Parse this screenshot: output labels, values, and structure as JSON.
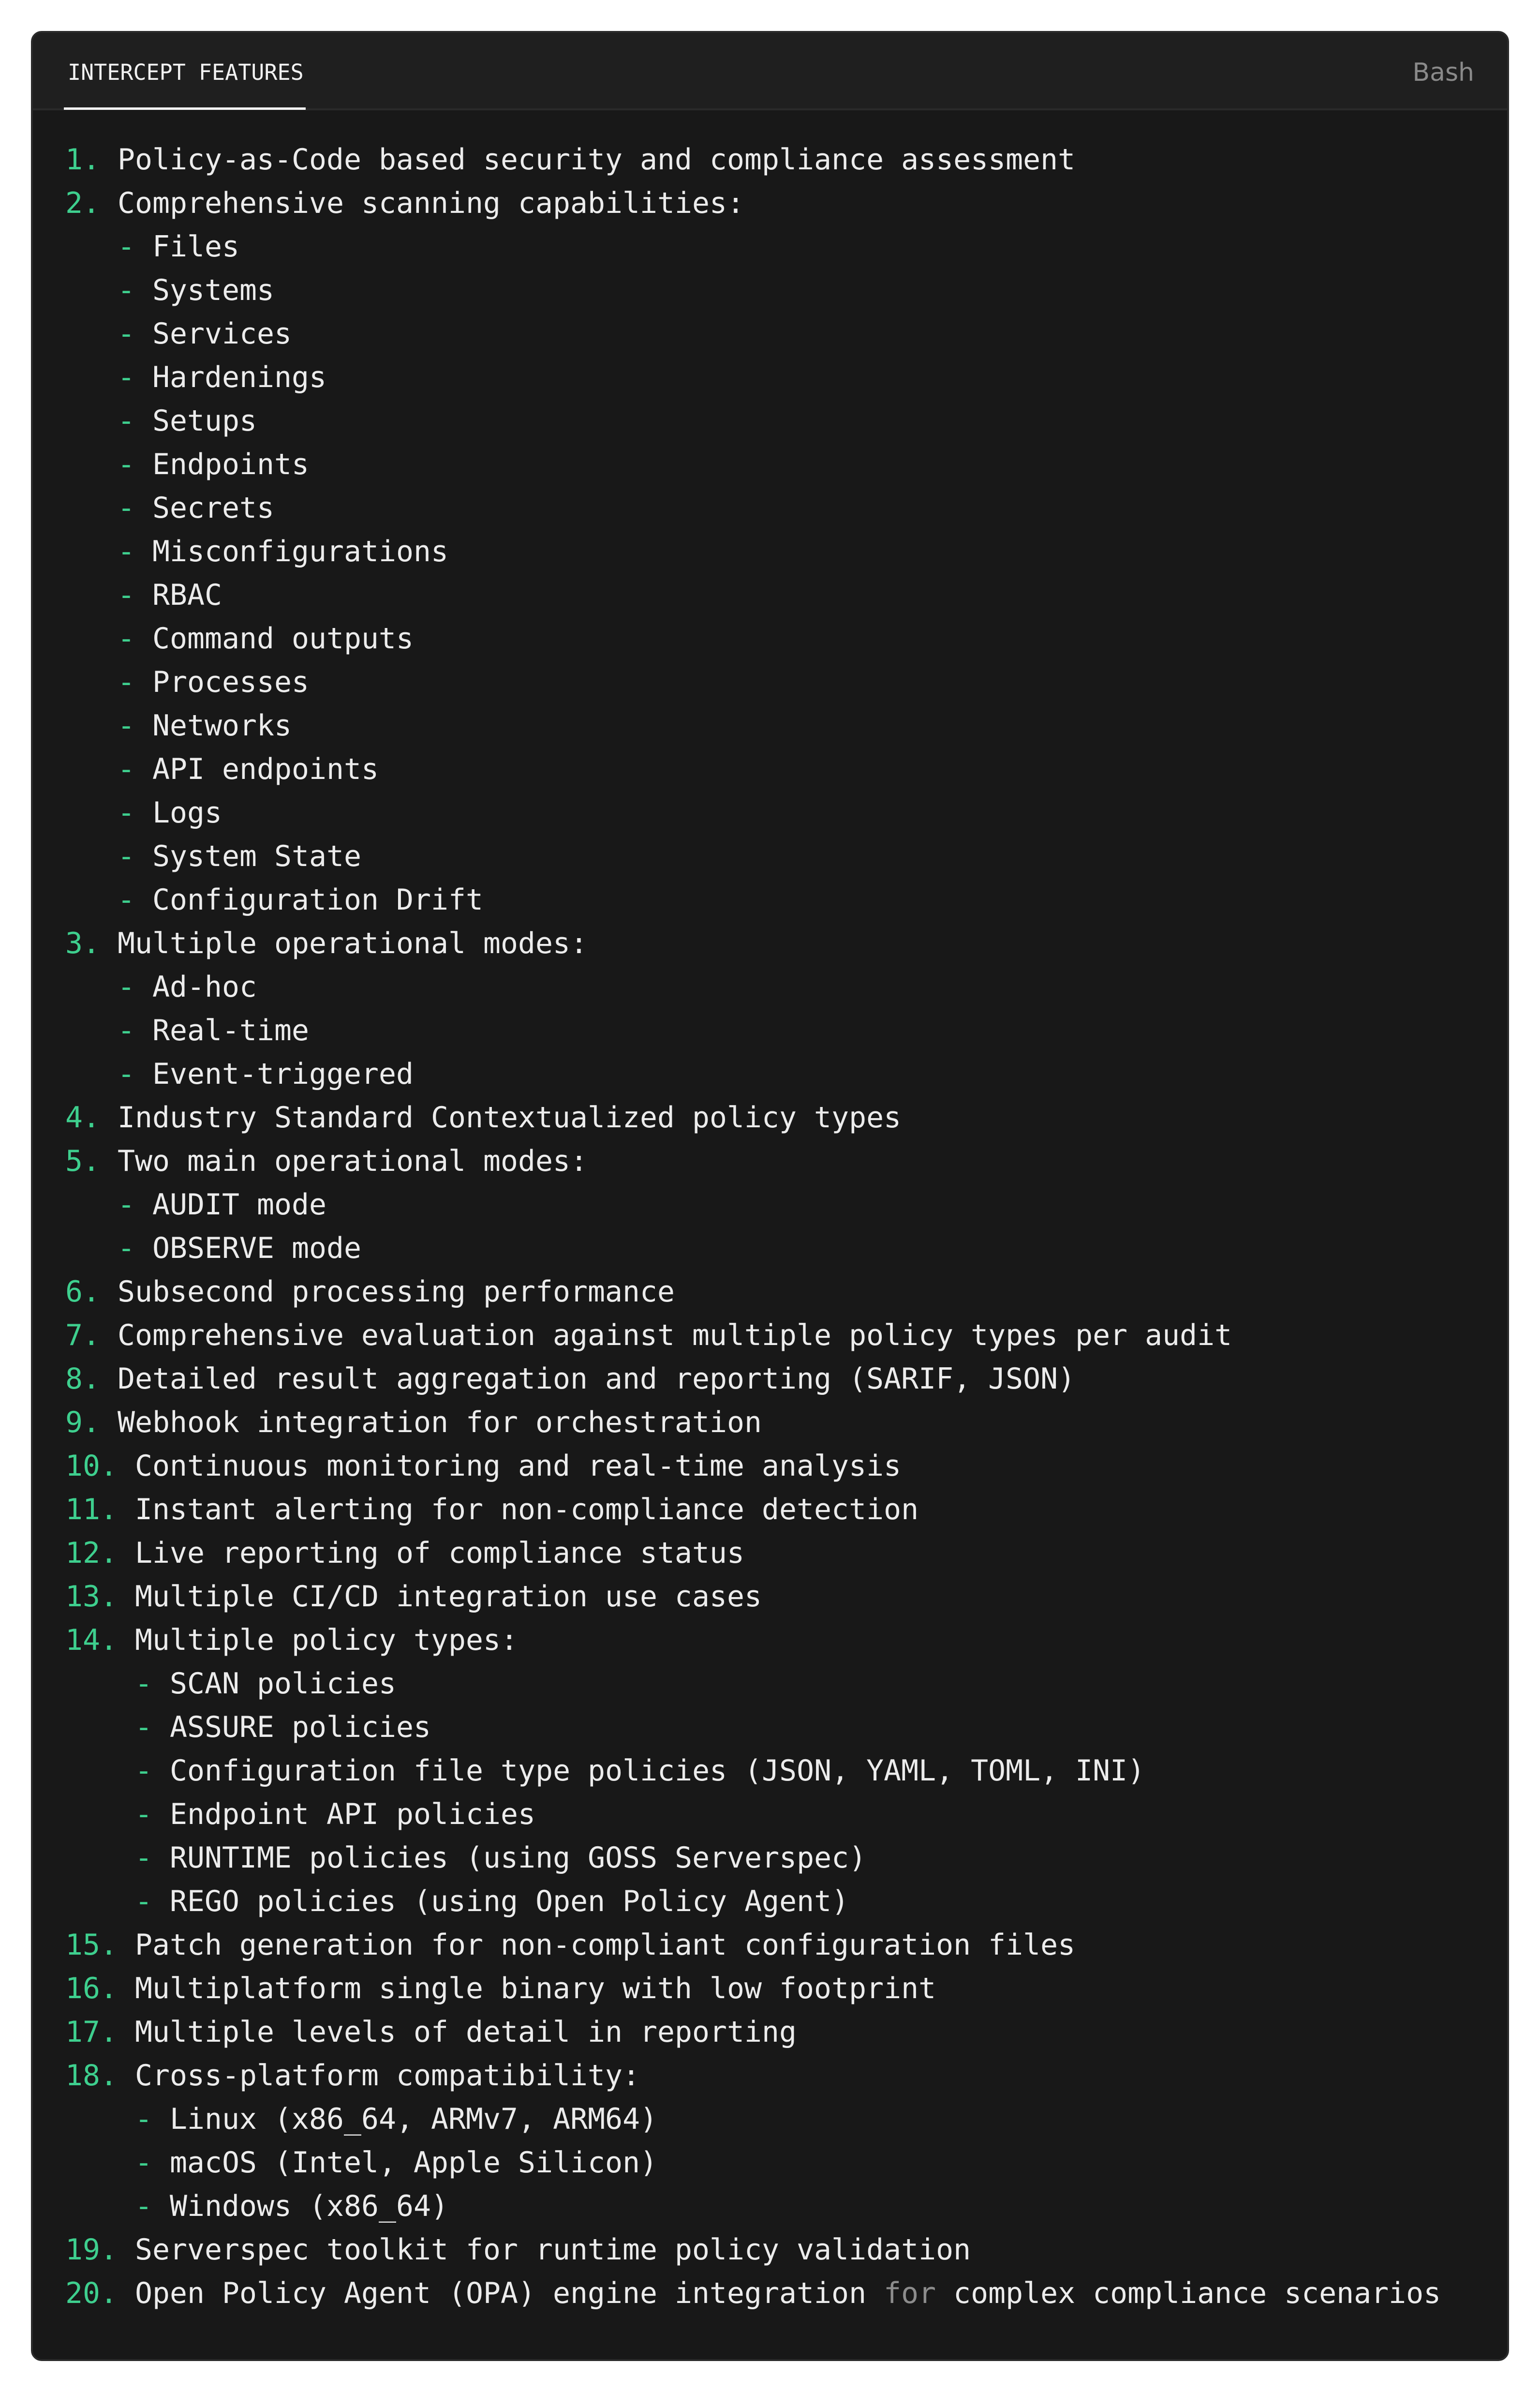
{
  "header": {
    "tab_label": "INTERCEPT FEATURES",
    "language": "Bash"
  },
  "colors": {
    "accent": "#3ecf8e",
    "text": "#ececec",
    "keyword": "#8c8c8c",
    "body_bg": "#181818",
    "header_bg": "#1f1f1f"
  },
  "lines": [
    {
      "type": "item",
      "marker": "1.",
      "text": "Policy-as-Code based security and compliance assessment"
    },
    {
      "type": "item",
      "marker": "2.",
      "text": "Comprehensive scanning capabilities:"
    },
    {
      "type": "sub",
      "indent": 3,
      "text": "Files"
    },
    {
      "type": "sub",
      "indent": 3,
      "text": "Systems"
    },
    {
      "type": "sub",
      "indent": 3,
      "text": "Services"
    },
    {
      "type": "sub",
      "indent": 3,
      "text": "Hardenings"
    },
    {
      "type": "sub",
      "indent": 3,
      "text": "Setups"
    },
    {
      "type": "sub",
      "indent": 3,
      "text": "Endpoints"
    },
    {
      "type": "sub",
      "indent": 3,
      "text": "Secrets"
    },
    {
      "type": "sub",
      "indent": 3,
      "text": "Misconfigurations"
    },
    {
      "type": "sub",
      "indent": 3,
      "text": "RBAC"
    },
    {
      "type": "sub",
      "indent": 3,
      "text": "Command outputs"
    },
    {
      "type": "sub",
      "indent": 3,
      "text": "Processes"
    },
    {
      "type": "sub",
      "indent": 3,
      "text": "Networks"
    },
    {
      "type": "sub",
      "indent": 3,
      "text": "API endpoints"
    },
    {
      "type": "sub",
      "indent": 3,
      "text": "Logs"
    },
    {
      "type": "sub",
      "indent": 3,
      "text": "System State"
    },
    {
      "type": "sub",
      "indent": 3,
      "text": "Configuration Drift"
    },
    {
      "type": "item",
      "marker": "3.",
      "text": "Multiple operational modes:"
    },
    {
      "type": "sub",
      "indent": 3,
      "text": "Ad-hoc"
    },
    {
      "type": "sub",
      "indent": 3,
      "text": "Real-time"
    },
    {
      "type": "sub",
      "indent": 3,
      "text": "Event-triggered"
    },
    {
      "type": "item",
      "marker": "4.",
      "text": "Industry Standard Contextualized policy types"
    },
    {
      "type": "item",
      "marker": "5.",
      "text": "Two main operational modes:"
    },
    {
      "type": "sub",
      "indent": 3,
      "text": "AUDIT mode"
    },
    {
      "type": "sub",
      "indent": 3,
      "text": "OBSERVE mode"
    },
    {
      "type": "item",
      "marker": "6.",
      "text": "Subsecond processing performance"
    },
    {
      "type": "item",
      "marker": "7.",
      "text": "Comprehensive evaluation against multiple policy types per audit"
    },
    {
      "type": "item",
      "marker": "8.",
      "text": "Detailed result aggregation and reporting (SARIF, JSON)"
    },
    {
      "type": "item",
      "marker": "9.",
      "text": "Webhook integration for orchestration"
    },
    {
      "type": "item",
      "marker": "10.",
      "text": "Continuous monitoring and real-time analysis"
    },
    {
      "type": "item",
      "marker": "11.",
      "text": "Instant alerting for non-compliance detection"
    },
    {
      "type": "item",
      "marker": "12.",
      "text": "Live reporting of compliance status"
    },
    {
      "type": "item",
      "marker": "13.",
      "text": "Multiple CI/CD integration use cases"
    },
    {
      "type": "item",
      "marker": "14.",
      "text": "Multiple policy types:"
    },
    {
      "type": "sub",
      "indent": 4,
      "text": "SCAN policies"
    },
    {
      "type": "sub",
      "indent": 4,
      "text": "ASSURE policies"
    },
    {
      "type": "sub",
      "indent": 4,
      "text": "Configuration file type policies (JSON, YAML, TOML, INI)"
    },
    {
      "type": "sub",
      "indent": 4,
      "text": "Endpoint API policies"
    },
    {
      "type": "sub",
      "indent": 4,
      "text": "RUNTIME policies (using GOSS Serverspec)"
    },
    {
      "type": "sub",
      "indent": 4,
      "text": "REGO policies (using Open Policy Agent)"
    },
    {
      "type": "item",
      "marker": "15.",
      "text": "Patch generation for non-compliant configuration files"
    },
    {
      "type": "item",
      "marker": "16.",
      "text": "Multiplatform single binary with low footprint"
    },
    {
      "type": "item",
      "marker": "17.",
      "text": "Multiple levels of detail in reporting"
    },
    {
      "type": "item",
      "marker": "18.",
      "text": "Cross-platform compatibility:"
    },
    {
      "type": "sub",
      "indent": 4,
      "text": "Linux (x86_64, ARMv7, ARM64)"
    },
    {
      "type": "sub",
      "indent": 4,
      "text": "macOS (Intel, Apple Silicon)"
    },
    {
      "type": "sub",
      "indent": 4,
      "text": "Windows (x86_64)"
    },
    {
      "type": "item",
      "marker": "19.",
      "text": "Serverspec toolkit for runtime policy validation"
    },
    {
      "type": "item",
      "marker": "20.",
      "segments": [
        {
          "text": "Open Policy Agent (OPA) engine integration ",
          "style": "plain"
        },
        {
          "text": "for",
          "style": "keyword"
        },
        {
          "text": " complex compliance scenarios",
          "style": "plain"
        }
      ]
    }
  ]
}
